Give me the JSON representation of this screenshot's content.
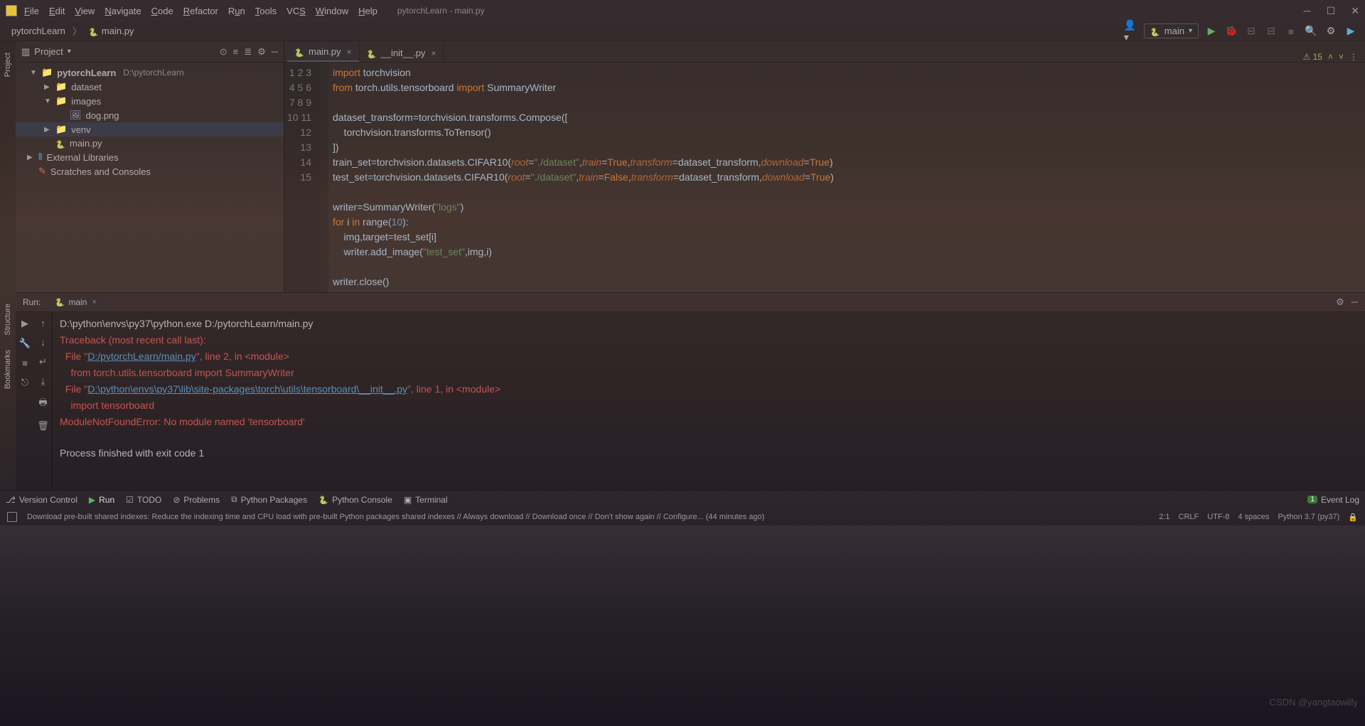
{
  "title": "pytorchLearn - main.py",
  "menu": [
    "File",
    "Edit",
    "View",
    "Navigate",
    "Code",
    "Refactor",
    "Run",
    "Tools",
    "VCS",
    "Window",
    "Help"
  ],
  "breadcrumb": {
    "project": "pytorchLearn",
    "file": "main.py"
  },
  "toolbar": {
    "config": "main"
  },
  "project_panel": {
    "title": "Project",
    "root": {
      "name": "pytorchLearn",
      "path": "D:\\pytorchLearn"
    },
    "items": [
      {
        "name": "dataset",
        "type": "folder",
        "depth": 1,
        "expand": "▶"
      },
      {
        "name": "images",
        "type": "folder",
        "depth": 1,
        "expand": "▼"
      },
      {
        "name": "dog.png",
        "type": "file",
        "depth": 2
      },
      {
        "name": "venv",
        "type": "folder-blue",
        "depth": 1,
        "expand": "▶"
      },
      {
        "name": "main.py",
        "type": "py",
        "depth": 1
      }
    ],
    "ext_lib": "External Libraries",
    "scratches": "Scratches and Consoles"
  },
  "tabs": [
    {
      "label": "main.py",
      "active": true
    },
    {
      "label": "__init__.py",
      "active": false
    }
  ],
  "inspection": {
    "count": "15"
  },
  "code_lines": [
    1,
    2,
    3,
    4,
    5,
    6,
    7,
    8,
    9,
    10,
    11,
    12,
    13,
    14,
    15
  ],
  "code": {
    "l1": {
      "kw1": "import",
      "id": "torchvision"
    },
    "l2": {
      "kw1": "from",
      "mod": "torch.utils.tensorboard",
      "kw2": "import",
      "cls": "SummaryWriter"
    },
    "l4": "dataset_transform=torchvision.transforms.Compose([",
    "l5": "    torchvision.transforms.ToTensor()",
    "l6": "])",
    "l7": {
      "pre": "train_set=torchvision.datasets.CIFAR10(",
      "p1": "root",
      "s1": "\"./dataset\"",
      "p2": "train",
      "v2": "True",
      "p3": "transform",
      "v3": "dataset_transform",
      "p4": "download",
      "v4": "True",
      "post": ")"
    },
    "l8": {
      "pre": "test_set=torchvision.datasets.CIFAR10(",
      "p1": "root",
      "s1": "\"./dataset\"",
      "p2": "train",
      "v2": "False",
      "p3": "transform",
      "v3": "dataset_transform",
      "p4": "download",
      "v4": "True",
      "post": ")"
    },
    "l10": {
      "pre": "writer=SummaryWriter(",
      "s": "\"logs\"",
      "post": ")"
    },
    "l11": {
      "kw1": "for",
      "v": "i",
      "kw2": "in",
      "fn": "range",
      "n": "10",
      "post": "):"
    },
    "l12": "    img,target=test_set[i]",
    "l13": {
      "pre": "    writer.add_image(",
      "s": "\"test_set\"",
      "mid": ",img,i)"
    },
    "l15": "writer.close()"
  },
  "run": {
    "title": "Run:",
    "tab": "main",
    "output": {
      "cmd": "D:\\python\\envs\\py37\\python.exe D:/pytorchLearn/main.py",
      "tb": "Traceback (most recent call last):",
      "f1a": "  File \"",
      "f1link": "D:/pytorchLearn/main.py",
      "f1b": "\", line 2, in <module>",
      "l1": "    from torch.utils.tensorboard import SummaryWriter",
      "f2a": "  File \"",
      "f2link": "D:\\python\\envs\\py37\\lib\\site-packages\\torch\\utils\\tensorboard\\__init__.py",
      "f2b": "\", line 1, in <module>",
      "l2": "    import tensorboard",
      "err": "ModuleNotFoundError: No module named 'tensorboard'",
      "exit": "Process finished with exit code 1"
    }
  },
  "bottom_tools": [
    "Version Control",
    "Run",
    "TODO",
    "Problems",
    "Python Packages",
    "Python Console",
    "Terminal"
  ],
  "bottom_right": {
    "badge": "1",
    "label": "Event Log"
  },
  "status": {
    "msg": "Download pre-built shared indexes: Reduce the indexing time and CPU load with pre-built Python packages shared indexes // Always download // Download once // Don't show again // Configure... (44 minutes ago)",
    "pos": "2:1",
    "sep": "CRLF",
    "enc": "UTF-8",
    "ind": "4 spaces",
    "py": "Python 3.7 (py37)"
  },
  "rails": {
    "project": "Project",
    "structure": "Structure",
    "bookmarks": "Bookmarks"
  },
  "watermark": "CSDN @yangtaowilly"
}
